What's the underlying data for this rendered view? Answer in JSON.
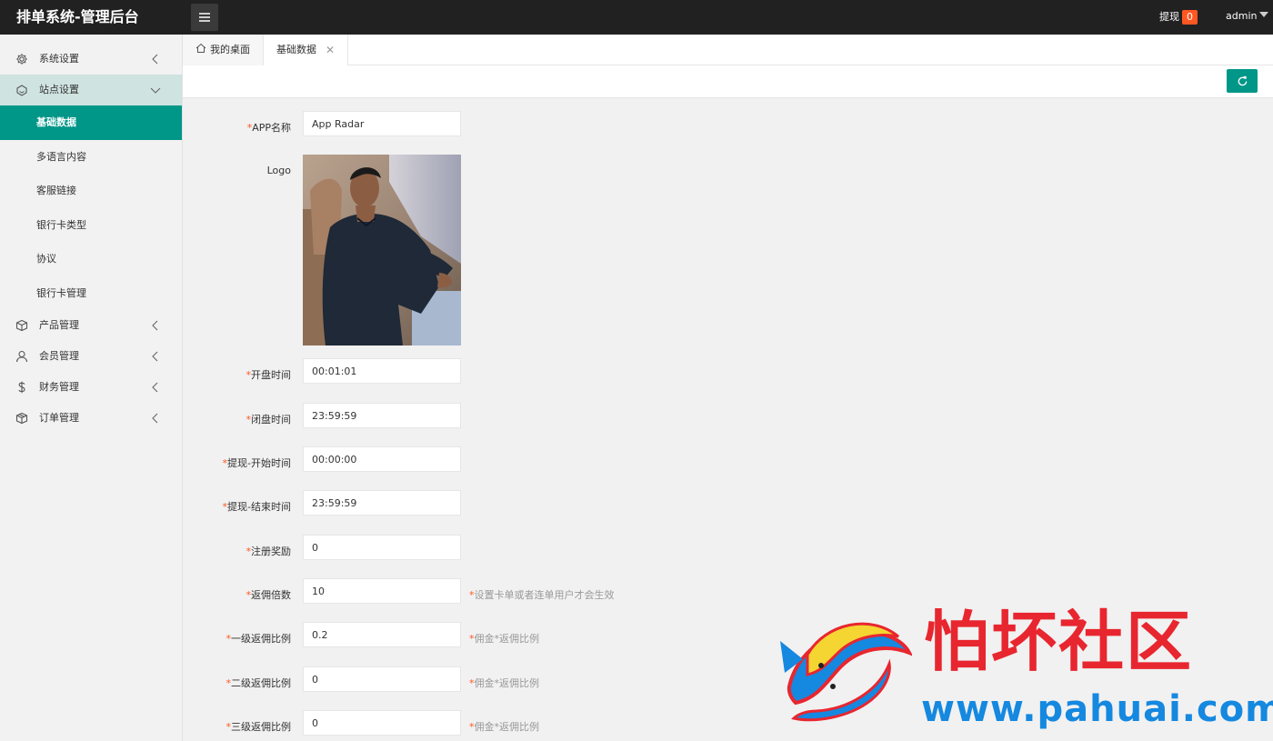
{
  "header": {
    "title": "排单系统-管理后台",
    "withdraw_label": "提现",
    "withdraw_count": "0",
    "user": "admin"
  },
  "sidebar": {
    "items": [
      {
        "label": "系统设置",
        "icon": "gear-icon"
      },
      {
        "label": "站点设置",
        "icon": "site-icon"
      },
      {
        "label": "产品管理",
        "icon": "box-icon"
      },
      {
        "label": "会员管理",
        "icon": "user-icon"
      },
      {
        "label": "财务管理",
        "icon": "dollar-icon"
      },
      {
        "label": "订单管理",
        "icon": "package-icon"
      }
    ],
    "sub_items": [
      "基础数据",
      "多语言内容",
      "客服链接",
      "银行卡类型",
      "协议",
      "银行卡管理"
    ]
  },
  "tabs": {
    "home": "我的桌面",
    "basic": "基础数据",
    "close": "✕"
  },
  "form": {
    "required_mark": "*",
    "app_name": {
      "label": "APP名称",
      "value": "App Radar"
    },
    "logo_label": "Logo",
    "open_time": {
      "label": "开盘时间",
      "value": "00:01:01"
    },
    "close_time": {
      "label": "闭盘时间",
      "value": "23:59:59"
    },
    "withdraw_start": {
      "label": "提现-开始时间",
      "value": "00:00:00"
    },
    "withdraw_end": {
      "label": "提现-结束时间",
      "value": "23:59:59"
    },
    "register_reward": {
      "label": "注册奖励",
      "value": "0"
    },
    "rebate_multiple": {
      "label": "返佣倍数",
      "value": "10",
      "hint": "设置卡单或者连单用户才会生效"
    },
    "rebate_level1": {
      "label": "一级返佣比例",
      "value": "0.2",
      "hint": "佣金*返佣比例"
    },
    "rebate_level2": {
      "label": "二级返佣比例",
      "value": "0",
      "hint": "佣金*返佣比例"
    },
    "rebate_level3": {
      "label": "三级返佣比例",
      "value": "0",
      "hint": "佣金*返佣比例"
    }
  },
  "watermark": {
    "text": "怕坏社区",
    "url": "www.pahuai.com"
  },
  "colors": {
    "header_bg": "#212121",
    "accent": "#009688",
    "badge": "#ff5722",
    "required": "#ff5722",
    "watermark_red": "#e8262f",
    "watermark_blue": "#1588e0"
  }
}
